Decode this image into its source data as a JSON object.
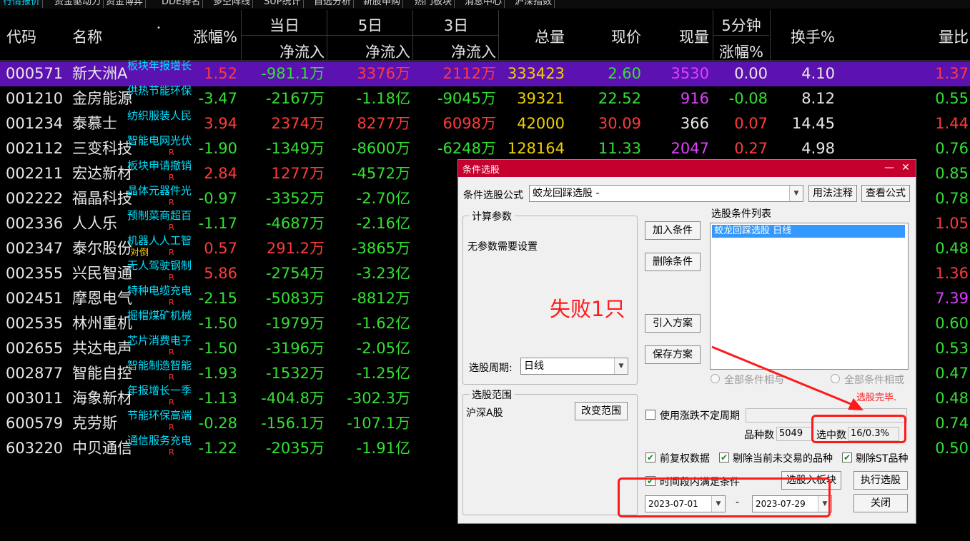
{
  "tabs": [
    "行情报价",
    "资金驱动力",
    "资金博弈",
    "DDE排名",
    "多空阵线",
    "SUP统计",
    "自选分析",
    "新股申购",
    "热门板块",
    "消息中心",
    "沪深指数"
  ],
  "header": {
    "code": "代码",
    "name": "名称",
    "change_pct": "涨幅%",
    "today": "当日",
    "five_day": "5日",
    "three_day": "3日",
    "net_inflow": "净流入",
    "total_volume": "总量",
    "price": "现价",
    "cur_volume": "现量",
    "five_min": "5分钟",
    "five_min_sub": "涨幅%",
    "turnover": "换手%",
    "vol_ratio": "量比"
  },
  "rows": [
    {
      "code": "000571",
      "name": "新大洲A",
      "tag": "板块年报增长",
      "r": false,
      "dx": false,
      "chg": "1.52",
      "chg_dir": "up",
      "today": "-981.1万",
      "today_dir": "dn",
      "d5": "3376万",
      "d5_dir": "up",
      "d3": "2112万",
      "d3_dir": "up",
      "vol": "333423",
      "price": "2.60",
      "price_dir": "dn",
      "curvol": "3530",
      "curvol_dir": "mg",
      "m5": "0.00",
      "m5_dir": "wh",
      "turn": "4.10",
      "ratio": "1.37",
      "ratio_dir": "up"
    },
    {
      "code": "001210",
      "name": "金房能源",
      "tag": "供热节能环保",
      "r": false,
      "dx": false,
      "chg": "-3.47",
      "chg_dir": "dn",
      "today": "-2167万",
      "today_dir": "dn",
      "d5": "-1.18亿",
      "d5_dir": "dn",
      "d3": "-9045万",
      "d3_dir": "dn",
      "vol": "39321",
      "price": "22.52",
      "price_dir": "dn",
      "curvol": "916",
      "curvol_dir": "mg",
      "m5": "-0.08",
      "m5_dir": "dn",
      "turn": "8.12",
      "ratio": "0.55",
      "ratio_dir": "dn"
    },
    {
      "code": "001234",
      "name": "泰慕士",
      "tag": "纺织服装人民",
      "r": false,
      "dx": false,
      "chg": "3.94",
      "chg_dir": "up",
      "today": "2374万",
      "today_dir": "up",
      "d5": "8277万",
      "d5_dir": "up",
      "d3": "6098万",
      "d3_dir": "up",
      "vol": "42000",
      "price": "30.09",
      "price_dir": "up",
      "curvol": "366",
      "curvol_dir": "wh",
      "m5": "0.07",
      "m5_dir": "up",
      "turn": "14.45",
      "ratio": "1.44",
      "ratio_dir": "up"
    },
    {
      "code": "002112",
      "name": "三变科技",
      "tag": "智能电网光伏",
      "r": true,
      "dx": false,
      "chg": "-1.90",
      "chg_dir": "dn",
      "today": "-1349万",
      "today_dir": "dn",
      "d5": "-8600万",
      "d5_dir": "dn",
      "d3": "-6248万",
      "d3_dir": "dn",
      "vol": "128164",
      "price": "11.33",
      "price_dir": "dn",
      "curvol": "2047",
      "curvol_dir": "mg",
      "m5": "0.27",
      "m5_dir": "up",
      "turn": "4.98",
      "ratio": "0.76",
      "ratio_dir": "dn"
    },
    {
      "code": "002211",
      "name": "宏达新材",
      "tag": "板块申请撤销",
      "r": true,
      "dx": false,
      "chg": "2.84",
      "chg_dir": "up",
      "today": "1277万",
      "today_dir": "up",
      "d5": "-4572万",
      "d5_dir": "dn",
      "d3": "-70",
      "d3_dir": "dn",
      "ratio": "0.85",
      "ratio_dir": "dn"
    },
    {
      "code": "002222",
      "name": "福晶科技",
      "tag": "晶体元器件光",
      "r": true,
      "dx": false,
      "chg": "-0.97",
      "chg_dir": "dn",
      "today": "-3352万",
      "today_dir": "dn",
      "d5": "-2.70亿",
      "d5_dir": "dn",
      "d3": "-",
      "d3_dir": "dn",
      "ratio": "0.78",
      "ratio_dir": "dn"
    },
    {
      "code": "002336",
      "name": "人人乐",
      "tag": "预制菜商超百",
      "r": true,
      "dx": false,
      "chg": "-1.17",
      "chg_dir": "dn",
      "today": "-4687万",
      "today_dir": "dn",
      "d5": "-2.16亿",
      "d5_dir": "dn",
      "d3": "-1",
      "d3_dir": "dn",
      "ratio": "1.05",
      "ratio_dir": "up"
    },
    {
      "code": "002347",
      "name": "泰尔股份",
      "tag": "机器人人工智",
      "r": true,
      "dx": true,
      "chg": "0.57",
      "chg_dir": "up",
      "today": "291.2万",
      "today_dir": "up",
      "d5": "-3865万",
      "d5_dir": "dn",
      "d3": "-27",
      "d3_dir": "dn",
      "ratio": "0.48",
      "ratio_dir": "dn"
    },
    {
      "code": "002355",
      "name": "兴民智通",
      "tag": "无人驾驶钢制",
      "r": true,
      "dx": false,
      "chg": "5.86",
      "chg_dir": "up",
      "today": "-2754万",
      "today_dir": "dn",
      "d5": "-3.23亿",
      "d5_dir": "dn",
      "d3": "-1",
      "d3_dir": "dn",
      "ratio": "1.36",
      "ratio_dir": "up"
    },
    {
      "code": "002451",
      "name": "摩恩电气",
      "tag": "特种电缆充电",
      "r": true,
      "dx": false,
      "chg": "-2.15",
      "chg_dir": "dn",
      "today": "-5083万",
      "today_dir": "dn",
      "d5": "-8812万",
      "d5_dir": "dn",
      "d3": "-95",
      "d3_dir": "dn",
      "ratio": "7.39",
      "ratio_dir": "mg"
    },
    {
      "code": "002535",
      "name": "林州重机",
      "tag": "掘帽煤矿机械",
      "r": false,
      "dx": false,
      "chg": "-1.50",
      "chg_dir": "dn",
      "today": "-1979万",
      "today_dir": "dn",
      "d5": "-1.62亿",
      "d5_dir": "dn",
      "d3": "-48",
      "d3_dir": "dn",
      "ratio": "0.60",
      "ratio_dir": "dn"
    },
    {
      "code": "002655",
      "name": "共达电声",
      "tag": "芯片消费电子",
      "r": true,
      "dx": false,
      "chg": "-1.50",
      "chg_dir": "dn",
      "today": "-3196万",
      "today_dir": "dn",
      "d5": "-2.05亿",
      "d5_dir": "dn",
      "d3": "-1",
      "d3_dir": "dn",
      "ratio": "0.53",
      "ratio_dir": "dn"
    },
    {
      "code": "002877",
      "name": "智能自控",
      "tag": "智能制造智能",
      "r": true,
      "dx": false,
      "chg": "-1.93",
      "chg_dir": "dn",
      "today": "-1532万",
      "today_dir": "dn",
      "d5": "-1.25亿",
      "d5_dir": "dn",
      "d3": "-63",
      "d3_dir": "dn",
      "ratio": "0.47",
      "ratio_dir": "dn"
    },
    {
      "code": "003011",
      "name": "海象新材",
      "tag": "年报增长一季",
      "r": true,
      "dx": false,
      "chg": "-1.13",
      "chg_dir": "dn",
      "today": "-404.8万",
      "today_dir": "dn",
      "d5": "-302.3万",
      "d5_dir": "dn",
      "d3": "-13",
      "d3_dir": "dn",
      "ratio": "0.48",
      "ratio_dir": "dn"
    },
    {
      "code": "600579",
      "name": "克劳斯",
      "tag": "节能环保高端",
      "r": true,
      "dx": false,
      "chg": "-0.28",
      "chg_dir": "dn",
      "today": "-156.1万",
      "today_dir": "dn",
      "d5": "-107.1万",
      "d5_dir": "dn",
      "d3": "-66",
      "d3_dir": "dn",
      "ratio": "0.74",
      "ratio_dir": "dn"
    },
    {
      "code": "603220",
      "name": "中贝通信",
      "tag": "通信服务充电",
      "r": true,
      "dx": false,
      "chg": "-1.22",
      "chg_dir": "dn",
      "today": "-2035万",
      "today_dir": "dn",
      "d5": "-1.91亿",
      "d5_dir": "dn",
      "d3": "-1",
      "d3_dir": "dn",
      "ratio": "0.50",
      "ratio_dir": "dn"
    }
  ],
  "flags": {
    "r": "R",
    "dx": "对倒"
  },
  "dialog": {
    "title": "条件选股",
    "formula_label": "条件选股公式",
    "formula_value": "蛟龙回踩选股 -",
    "usage_btn": "用法注释",
    "view_formula_btn": "查看公式",
    "calc_params_title": "计算参数",
    "no_params": "无参数需要设置",
    "fail_text": "失败1只",
    "add_condition": "加入条件",
    "delete_condition": "删除条件",
    "import_plan": "引入方案",
    "save_plan": "保存方案",
    "condition_list_title": "选股条件列表",
    "condition_item": "蛟龙回踩选股  日线",
    "all_and": "全部条件相与",
    "all_or": "全部条件相或",
    "period_label": "选股周期:",
    "period_value": "日线",
    "range_title": "选股范围",
    "range_value": "沪深A股",
    "change_range": "改变范围",
    "done_text": "选股完毕.",
    "use_uncertain_period": "使用涨跌不定周期",
    "stock_count_label": "品种数",
    "stock_count": "5049",
    "selected_label": "选中数",
    "selected_value": "16/0.3%",
    "pre_adjust": "前复权数据",
    "exclude_untraded": "剔除当前未交易的品种",
    "exclude_st": "剔除ST品种",
    "time_range_cond": "时间段内满足条件",
    "select_into_block": "选股入板块",
    "execute": "执行选股",
    "date_from": "2023-07-01",
    "date_sep": "-",
    "date_to": "2023-07-29",
    "close": "关闭"
  },
  "colors": {
    "up": "#ff3b3b",
    "down": "#33e033",
    "tag": "#00e0ff",
    "selected_row": "#5c12b0",
    "dialog_title": "#c5002f",
    "annotation": "#ff1a1a"
  }
}
